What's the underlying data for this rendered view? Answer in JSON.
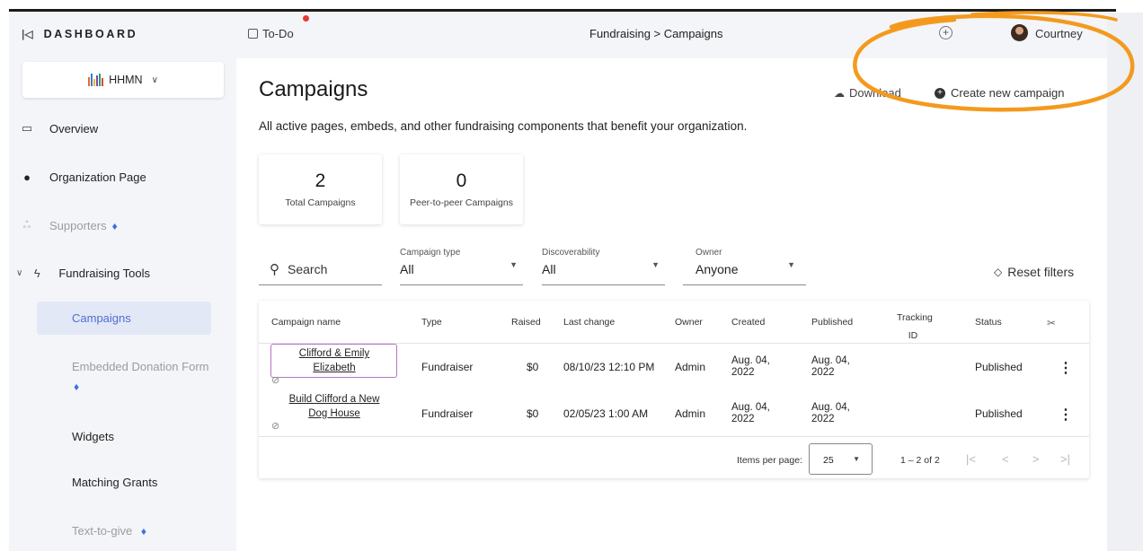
{
  "sidebar": {
    "collapse_icon": "collapse-sidebar-icon",
    "dashboard_label": "DASHBOARD",
    "org": {
      "name": "HHMN",
      "logo": "hhmn-logo-icon"
    },
    "items": [
      {
        "label": "Overview",
        "icon": "monitor-icon"
      },
      {
        "label": "Organization Page",
        "icon": "check-circle-icon"
      },
      {
        "label": "Supporters",
        "icon": "users-icon"
      },
      {
        "label": "Fundraising Tools",
        "icon": "lightning-icon"
      }
    ],
    "subitems": [
      {
        "label": "Campaigns"
      },
      {
        "label": "Embedded Donation Form"
      },
      {
        "label": "Widgets"
      },
      {
        "label": "Matching Grants"
      },
      {
        "label": "Text-to-give"
      }
    ]
  },
  "header": {
    "todo_label": "To-Do",
    "breadcrumb": "Fundraising  >  Campaigns",
    "user_name": "Courtney"
  },
  "main": {
    "title": "Campaigns",
    "download_label": "Download",
    "create_label": "Create new campaign",
    "subtitle": "All active pages, embeds, and other fundraising components that benefit your organization.",
    "stats": [
      {
        "value": "2",
        "label": "Total Campaigns"
      },
      {
        "value": "0",
        "label": "Peer-to-peer Campaigns"
      }
    ],
    "search_placeholder": "Search",
    "filters": [
      {
        "label": "Campaign type",
        "value": "All"
      },
      {
        "label": "Discoverability",
        "value": "All"
      },
      {
        "label": "Owner",
        "value": "Anyone"
      }
    ],
    "reset_label": "Reset filters"
  },
  "table": {
    "headers": [
      "Campaign name",
      "Type",
      "Raised",
      "Last change",
      "Owner",
      "Created",
      "Published",
      "Tracking ID",
      "Status"
    ],
    "tracking_header_line1": "Tracking",
    "tracking_header_line2": "ID",
    "rows": [
      {
        "name_line1": "Clifford & Emily",
        "name_line2": "Elizabeth",
        "type": "Fundraiser",
        "raised": "$0",
        "last_change": "08/10/23 12:10 PM",
        "owner": "Admin",
        "created_line1": "Aug. 04,",
        "created_line2": "2022",
        "published_line1": "Aug. 04,",
        "published_line2": "2022",
        "status": "Published"
      },
      {
        "name_line1": "Build Clifford a New",
        "name_line2": "Dog House",
        "type": "Fundraiser",
        "raised": "$0",
        "last_change": "02/05/23 1:00 AM",
        "owner": "Admin",
        "created_line1": "Aug. 04,",
        "created_line2": "2022",
        "published_line1": "Aug. 04,",
        "published_line2": "2022",
        "status": "Published"
      }
    ],
    "items_per_page_label": "Items per page:",
    "items_per_page": "25",
    "range_label": "1 – 2 of 2"
  },
  "colors": {
    "sidebar_bg": "#f4f5f8",
    "active_bg": "#e3e8f6",
    "annotation_orange": "#f39a1e",
    "highlight_purple": "#b673c9",
    "drop_blue": "#3a72e6"
  }
}
